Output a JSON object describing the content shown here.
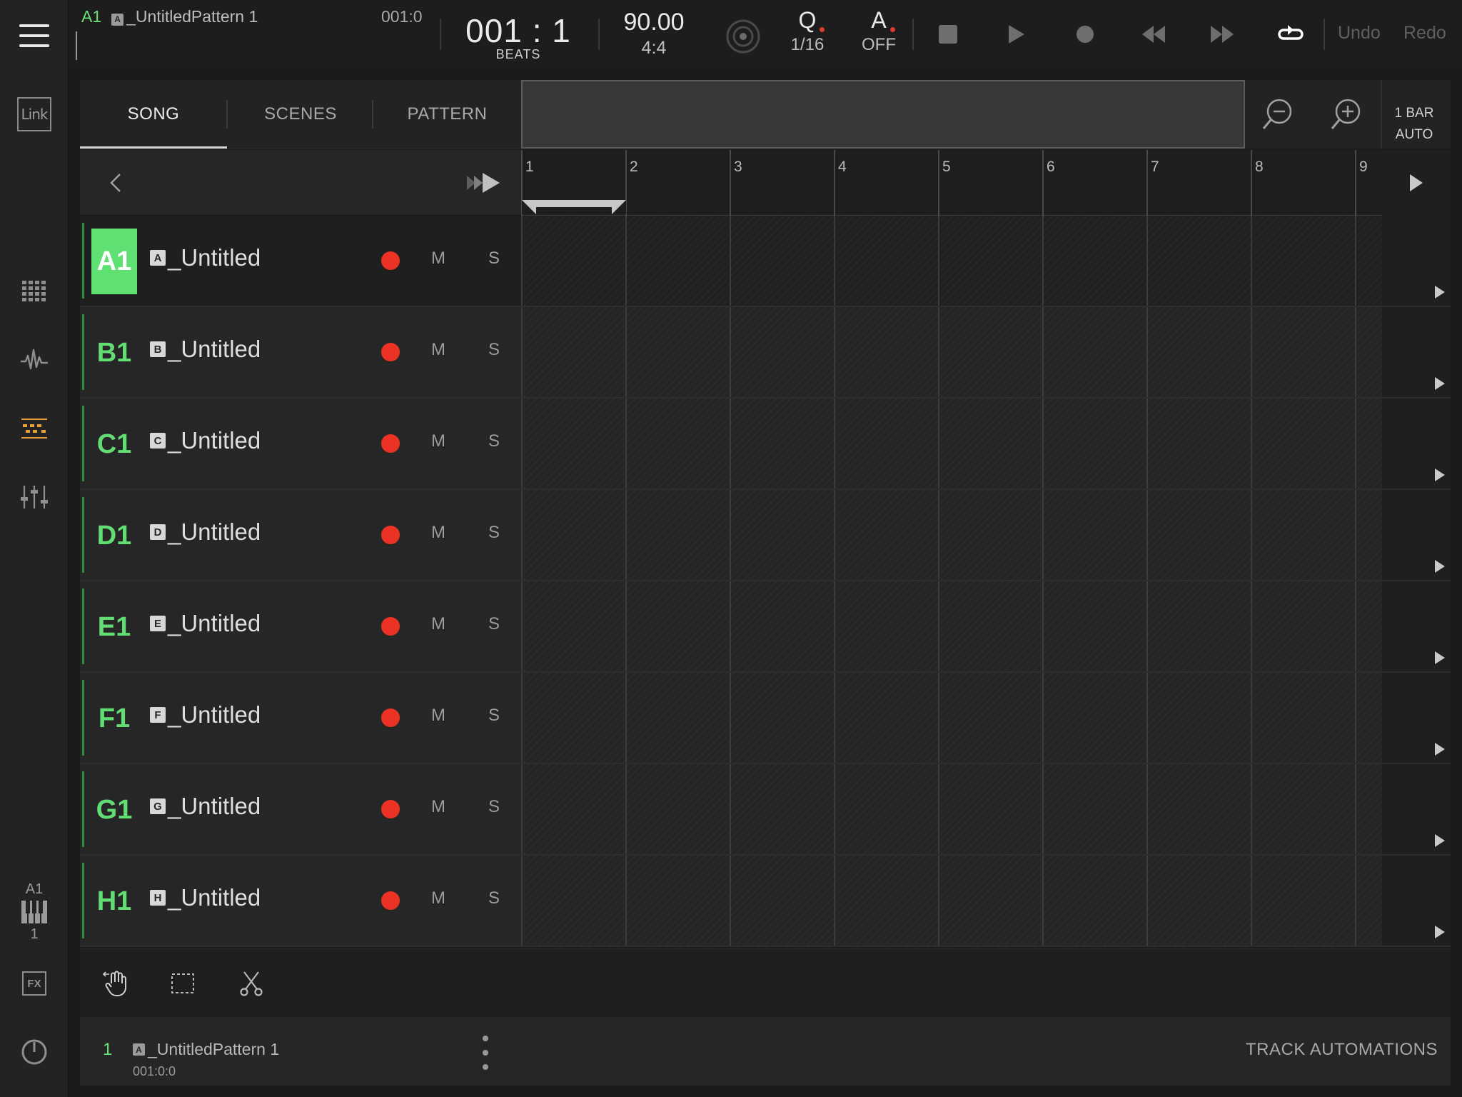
{
  "transport": {
    "track": "A1",
    "pattern_badge": "A",
    "pattern_name": "_UntitledPattern 1",
    "pattern_pos": "001:0",
    "position_bar": "001",
    "position_sep": ":",
    "position_beat": "1",
    "position_unit": "BEATS",
    "tempo": "90.00",
    "signature": "4:4",
    "quantize_label": "Q",
    "quantize_value": "1/16",
    "auto_label": "A",
    "auto_value": "OFF",
    "undo": "Undo",
    "redo": "Redo"
  },
  "sidebar": {
    "link_label": "Link",
    "keys_track": "A1",
    "keys_octave": "1",
    "fx_label": "FX",
    "active_color": "#e8a03a"
  },
  "tabs": [
    {
      "label": "SONG",
      "active": true
    },
    {
      "label": "SCENES",
      "active": false
    },
    {
      "label": "PATTERN",
      "active": false
    }
  ],
  "zoom": {
    "bar_size": "1 BAR",
    "mode": "AUTO"
  },
  "ruler": {
    "bars": [
      "1",
      "2",
      "3",
      "4",
      "5",
      "6",
      "7",
      "8",
      "9"
    ]
  },
  "tracks": [
    {
      "id": "A1",
      "badge": "A",
      "name": "_Untitled",
      "mute": "M",
      "solo": "S",
      "selected": true
    },
    {
      "id": "B1",
      "badge": "B",
      "name": "_Untitled",
      "mute": "M",
      "solo": "S",
      "selected": false
    },
    {
      "id": "C1",
      "badge": "C",
      "name": "_Untitled",
      "mute": "M",
      "solo": "S",
      "selected": false
    },
    {
      "id": "D1",
      "badge": "D",
      "name": "_Untitled",
      "mute": "M",
      "solo": "S",
      "selected": false
    },
    {
      "id": "E1",
      "badge": "E",
      "name": "_Untitled",
      "mute": "M",
      "solo": "S",
      "selected": false
    },
    {
      "id": "F1",
      "badge": "F",
      "name": "_Untitled",
      "mute": "M",
      "solo": "S",
      "selected": false
    },
    {
      "id": "G1",
      "badge": "G",
      "name": "_Untitled",
      "mute": "M",
      "solo": "S",
      "selected": false
    },
    {
      "id": "H1",
      "badge": "H",
      "name": "_Untitled",
      "mute": "M",
      "solo": "S",
      "selected": false
    }
  ],
  "status": {
    "index": "1",
    "badge": "A",
    "pattern_name": "_UntitledPattern 1",
    "position": "001:0:0",
    "track_automations": "TRACK AUTOMATIONS"
  },
  "colors": {
    "accent_green": "#5fe072",
    "record_red": "#ea3325"
  }
}
